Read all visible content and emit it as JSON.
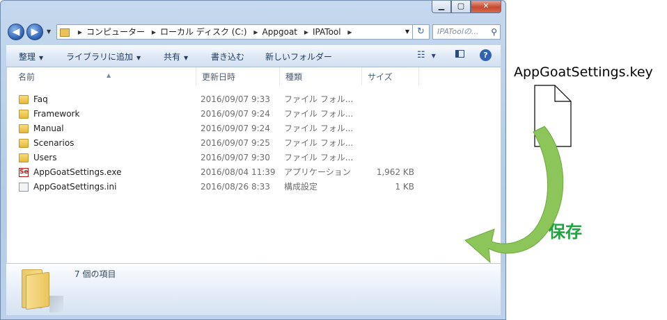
{
  "window": {
    "caption_buttons": {
      "minimize": "▁",
      "maximize": "▢",
      "close": "✕"
    },
    "nav": {
      "back_icon": "back-arrow-icon",
      "forward_icon": "forward-arrow-icon"
    },
    "address": {
      "segments": [
        "コンピューター",
        "ローカル ディスク (C:)",
        "Appgoat",
        "IPATool"
      ],
      "refresh_icon": "↻"
    },
    "search": {
      "placeholder": "IPAToolの..."
    },
    "toolbar": {
      "organize": "整理",
      "include_library": "ライブラリに追加",
      "share": "共有",
      "burn": "書き込む",
      "new_folder": "新しいフォルダー",
      "help_icon": "?"
    },
    "columns": {
      "name": "名前",
      "date": "更新日時",
      "type": "種類",
      "size": "サイズ"
    },
    "files": [
      {
        "name": "Faq",
        "date": "2016/09/07 9:33",
        "type": "ファイル フォル...",
        "size": "",
        "icon": "folder"
      },
      {
        "name": "Framework",
        "date": "2016/09/07 9:24",
        "type": "ファイル フォル...",
        "size": "",
        "icon": "folder"
      },
      {
        "name": "Manual",
        "date": "2016/09/07 9:24",
        "type": "ファイル フォル...",
        "size": "",
        "icon": "folder"
      },
      {
        "name": "Scenarios",
        "date": "2016/09/07 9:25",
        "type": "ファイル フォル...",
        "size": "",
        "icon": "folder"
      },
      {
        "name": "Users",
        "date": "2016/09/07 9:30",
        "type": "ファイル フォル...",
        "size": "",
        "icon": "folder"
      },
      {
        "name": "AppGoatSettings.exe",
        "date": "2016/08/04 11:39",
        "type": "アプリケーション",
        "size": "1,962 KB",
        "icon": "exe"
      },
      {
        "name": "AppGoatSettings.ini",
        "date": "2016/08/26 8:33",
        "type": "構成設定",
        "size": "1 KB",
        "icon": "ini"
      }
    ],
    "exe_icon_text": "Set",
    "status": {
      "item_count": "7 個の項目"
    }
  },
  "annotation": {
    "file_label": "AppGoatSettings.key",
    "action_label": "保存",
    "arrow_color": "#8cc55a"
  }
}
